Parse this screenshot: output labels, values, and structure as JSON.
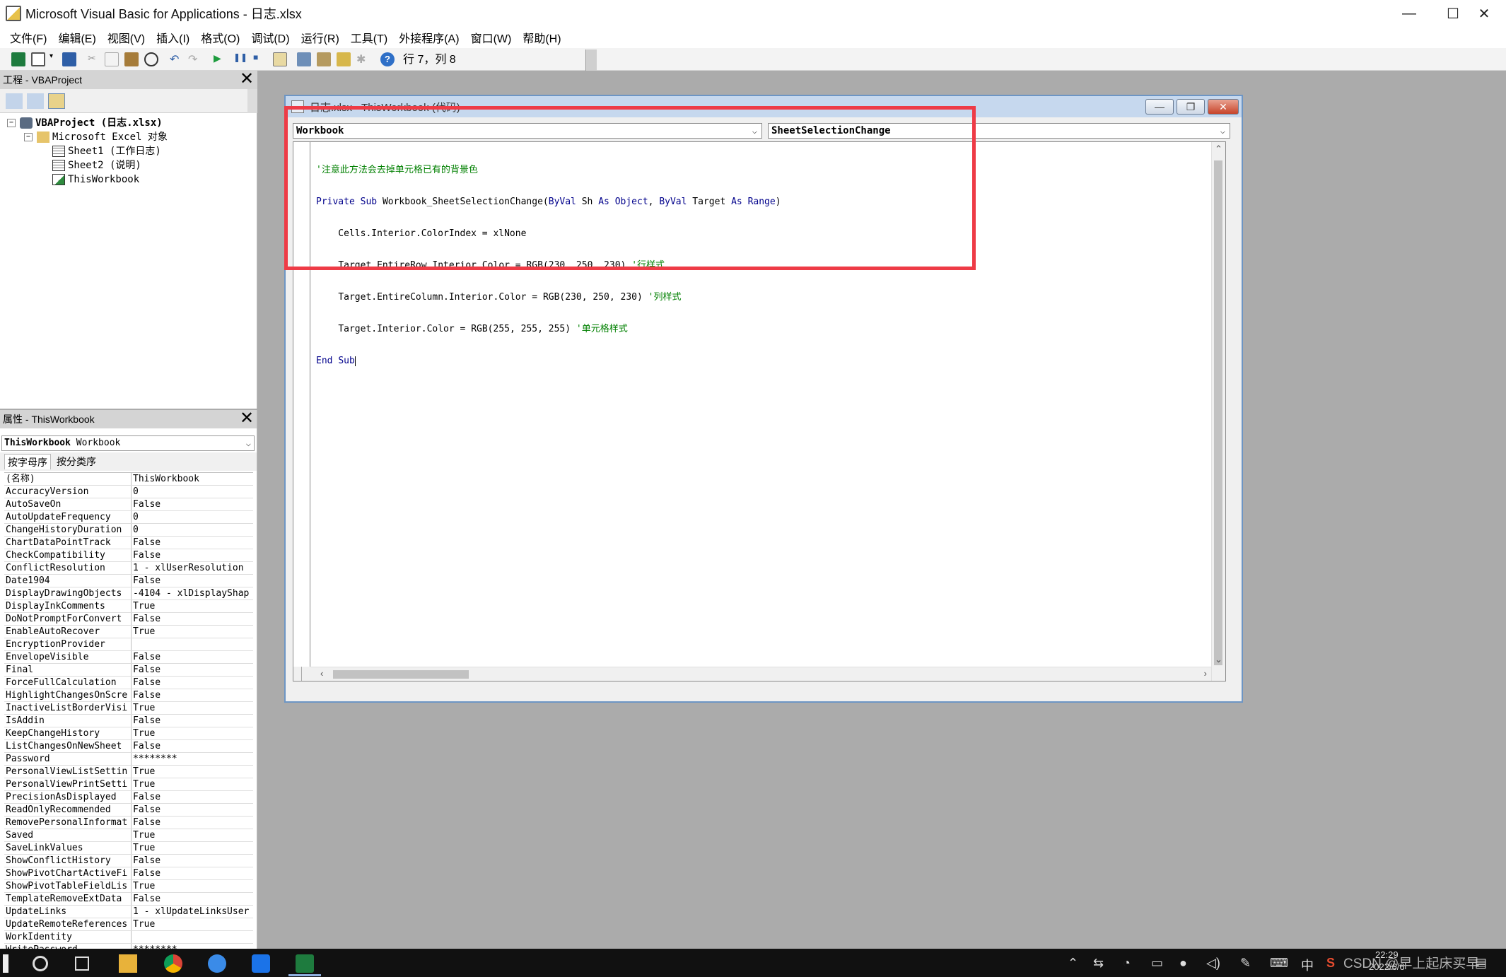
{
  "window": {
    "title": "Microsoft Visual Basic for Applications - 日志.xlsx",
    "controls": {
      "minimize": "—",
      "maximize": "☐",
      "close": "✕"
    }
  },
  "menu": [
    "文件(F)",
    "编辑(E)",
    "视图(V)",
    "插入(I)",
    "格式(O)",
    "调试(D)",
    "运行(R)",
    "工具(T)",
    "外接程序(A)",
    "窗口(W)",
    "帮助(H)"
  ],
  "toolbar": {
    "status": "行 7，列 8",
    "icons": [
      "excel-icon",
      "insert-module-icon",
      "save-icon",
      "cut-icon",
      "copy-icon",
      "paste-icon",
      "find-icon",
      "undo-icon",
      "redo-icon",
      "run-icon",
      "break-icon",
      "reset-icon",
      "design-mode-icon",
      "project-explorer-icon",
      "properties-icon",
      "object-browser-icon",
      "toolbox-icon",
      "help-icon"
    ]
  },
  "project_panel": {
    "title": "工程 - VBAProject",
    "close": "✕",
    "tree": [
      {
        "label": "VBAProject (日志.xlsx)",
        "expander": "−",
        "icon": "vbaproject-icon"
      },
      {
        "label": "Microsoft Excel 对象",
        "expander": "−",
        "icon": "folder-icon"
      },
      {
        "label": "Sheet1 (工作日志)",
        "expander": "",
        "icon": "sheet-icon"
      },
      {
        "label": "Sheet2 (说明)",
        "expander": "",
        "icon": "sheet-icon"
      },
      {
        "label": "ThisWorkbook",
        "expander": "",
        "icon": "workbook-icon"
      }
    ]
  },
  "properties_panel": {
    "title": "属性 - ThisWorkbook",
    "close": "✕",
    "object_name": "ThisWorkbook",
    "object_type": "Workbook",
    "tabs": [
      "按字母序",
      "按分类序"
    ],
    "rows": [
      {
        "name": "(名称)",
        "value": "ThisWorkbook"
      },
      {
        "name": "AccuracyVersion",
        "value": "0"
      },
      {
        "name": "AutoSaveOn",
        "value": "False"
      },
      {
        "name": "AutoUpdateFrequency",
        "value": "0"
      },
      {
        "name": "ChangeHistoryDuration",
        "value": "0"
      },
      {
        "name": "ChartDataPointTrack",
        "value": "False"
      },
      {
        "name": "CheckCompatibility",
        "value": "False"
      },
      {
        "name": "ConflictResolution",
        "value": "1 - xlUserResolution"
      },
      {
        "name": "Date1904",
        "value": "False"
      },
      {
        "name": "DisplayDrawingObjects",
        "value": "-4104 - xlDisplayShap"
      },
      {
        "name": "DisplayInkComments",
        "value": "True"
      },
      {
        "name": "DoNotPromptForConvert",
        "value": "False"
      },
      {
        "name": "EnableAutoRecover",
        "value": "True"
      },
      {
        "name": "EncryptionProvider",
        "value": ""
      },
      {
        "name": "EnvelopeVisible",
        "value": "False"
      },
      {
        "name": "Final",
        "value": "False"
      },
      {
        "name": "ForceFullCalculation",
        "value": "False"
      },
      {
        "name": "HighlightChangesOnScre",
        "value": "False"
      },
      {
        "name": "InactiveListBorderVisi",
        "value": "True"
      },
      {
        "name": "IsAddin",
        "value": "False"
      },
      {
        "name": "KeepChangeHistory",
        "value": "True"
      },
      {
        "name": "ListChangesOnNewSheet",
        "value": "False"
      },
      {
        "name": "Password",
        "value": "********"
      },
      {
        "name": "PersonalViewListSettin",
        "value": "True"
      },
      {
        "name": "PersonalViewPrintSetti",
        "value": "True"
      },
      {
        "name": "PrecisionAsDisplayed",
        "value": "False"
      },
      {
        "name": "ReadOnlyRecommended",
        "value": "False"
      },
      {
        "name": "RemovePersonalInformat",
        "value": "False"
      },
      {
        "name": "Saved",
        "value": "True"
      },
      {
        "name": "SaveLinkValues",
        "value": "True"
      },
      {
        "name": "ShowConflictHistory",
        "value": "False"
      },
      {
        "name": "ShowPivotChartActiveFi",
        "value": "False"
      },
      {
        "name": "ShowPivotTableFieldLis",
        "value": "True"
      },
      {
        "name": "TemplateRemoveExtData",
        "value": "False"
      },
      {
        "name": "UpdateLinks",
        "value": "1 - xlUpdateLinksUser"
      },
      {
        "name": "UpdateRemoteReferences",
        "value": "True"
      },
      {
        "name": "WorkIdentity",
        "value": ""
      },
      {
        "name": "WritePassword",
        "value": "********"
      }
    ]
  },
  "code_window": {
    "title": "日志.xlsx - ThisWorkbook (代码)",
    "object_combo": "Workbook",
    "procedure_combo": "SheetSelectionChange",
    "code_lines": [
      "'注意此方法会去掉单元格已有的背景色",
      "Private Sub Workbook_SheetSelectionChange(ByVal Sh As Object, ByVal Target As Range)",
      "    Cells.Interior.ColorIndex = xlNone",
      "    Target.EntireRow.Interior.Color = RGB(230, 250, 230) '行样式",
      "    Target.EntireColumn.Interior.Color = RGB(230, 250, 230) '列样式",
      "    Target.Interior.Color = RGB(255, 255, 255) '单元格样式",
      "End Sub"
    ]
  },
  "taskbar": {
    "tray_lang": "中",
    "clock_time": "22:29",
    "clock_date": "2022/6/6",
    "watermark": "CSDN @早上起床买早"
  },
  "colors": {
    "highlight": "#ee3b46",
    "keyword": "#00008b",
    "comment": "#008000",
    "code_window_border": "#6d95c4"
  }
}
